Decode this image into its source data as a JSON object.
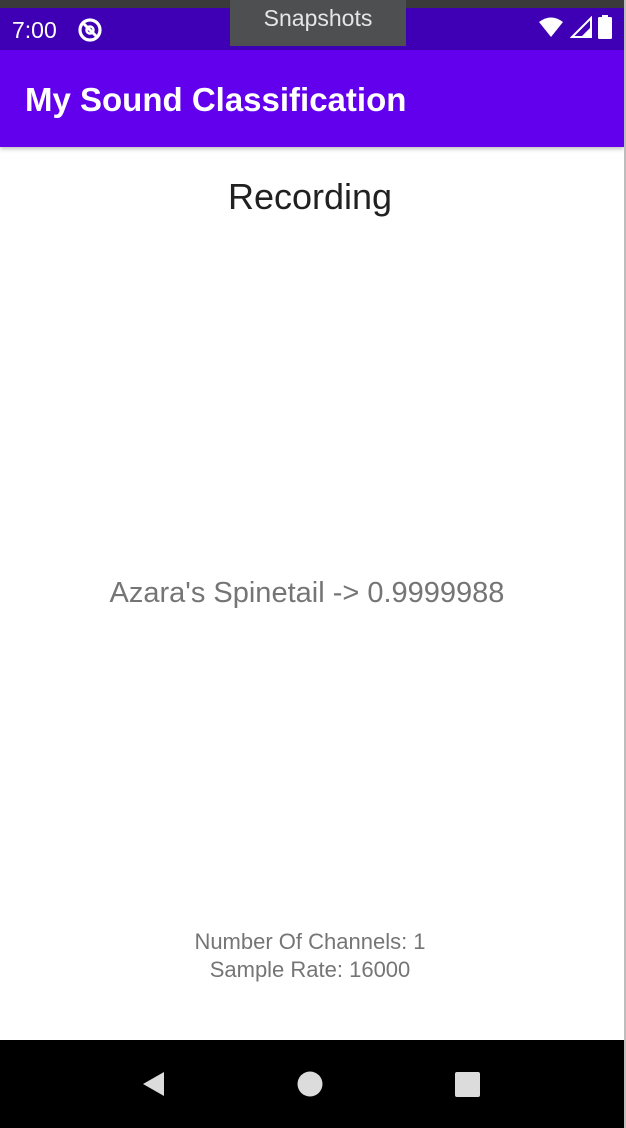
{
  "status_bar": {
    "time": "7:00",
    "icons": [
      "app-notification-icon",
      "wifi-icon",
      "signal-icon",
      "battery-icon"
    ]
  },
  "tooltip": {
    "label": "Snapshots"
  },
  "app_bar": {
    "title": "My Sound Classification",
    "color": "#6200ee"
  },
  "main": {
    "status": "Recording",
    "result": "Azara's Spinetail -> 0.9999988",
    "channels": "Number Of Channels: 1",
    "sample_rate": "Sample Rate: 16000"
  },
  "nav_bar": {
    "buttons": [
      "back-icon",
      "home-icon",
      "recents-icon"
    ]
  }
}
